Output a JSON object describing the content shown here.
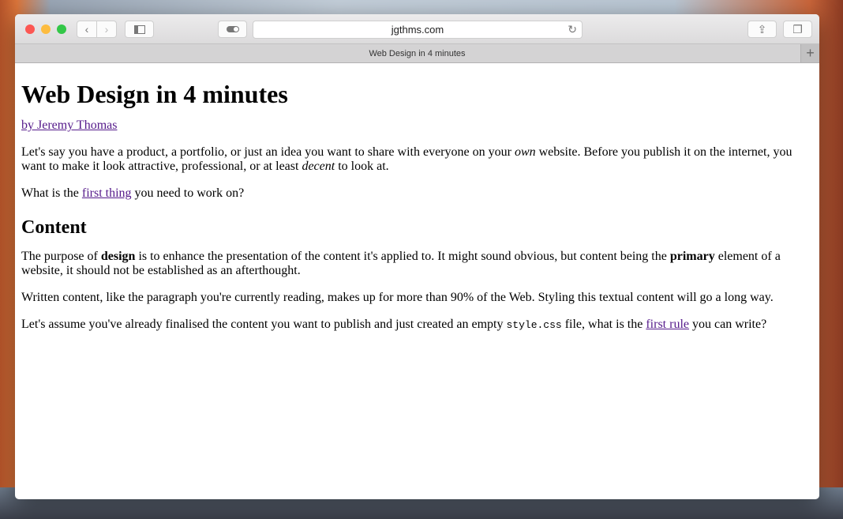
{
  "browser": {
    "url": "jgthms.com",
    "tab_title": "Web Design in 4 minutes",
    "colors": {
      "close": "#fc5753",
      "minimize": "#fdbc40",
      "zoom": "#33c748"
    }
  },
  "page": {
    "title": "Web Design in 4 minutes",
    "byline": "by Jeremy Thomas",
    "intro": {
      "t1": "Let's say you have a product, a portfolio, or just an idea you want to share with everyone on your ",
      "em1": "own",
      "t2": " website. Before you publish it on the internet, you want to make it look attractive, professional, or at least ",
      "em2": "decent",
      "t3": " to look at."
    },
    "question": {
      "t1": "What is the ",
      "link": "first thing",
      "t2": " you need to work on?"
    },
    "section_title": "Content",
    "p1": {
      "t1": "The purpose of ",
      "b1": "design",
      "t2": " is to enhance the presentation of the content it's applied to. It might sound obvious, but content being the ",
      "b2": "primary",
      "t3": " element of a website, it should not be established as an afterthought."
    },
    "p2": "Written content, like the paragraph you're currently reading, makes up for more than 90% of the Web. Styling this textual content will go a long way.",
    "p3": {
      "t1": "Let's assume you've already finalised the content you want to publish and just created an empty ",
      "code": "style.css",
      "t2": " file, what is the ",
      "link": "first rule",
      "t3": " you can write?"
    }
  }
}
